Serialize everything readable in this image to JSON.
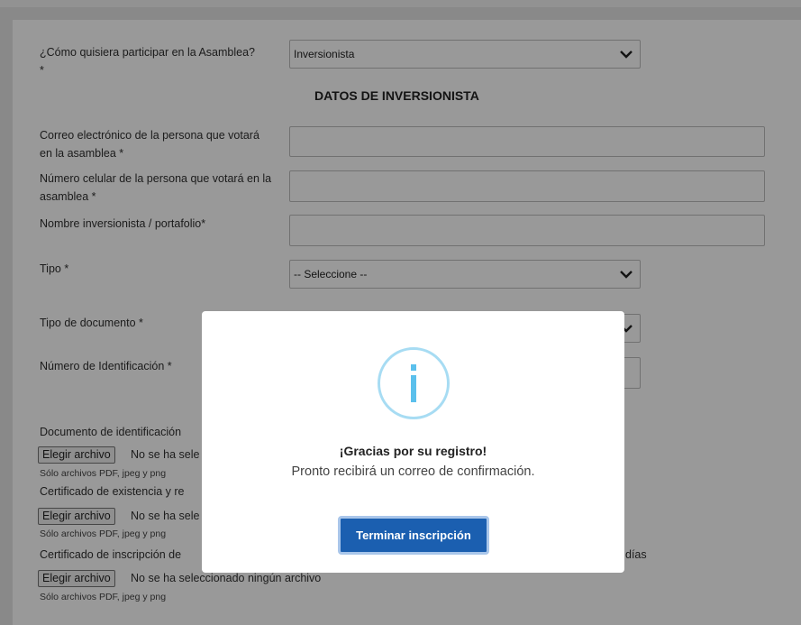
{
  "form": {
    "participation_label": "¿Cómo quisiera participar en la Asamblea? *",
    "participation_value": "Inversionista",
    "section_title": "DATOS DE INVERSIONISTA",
    "email_label": "Correo electrónico de la persona que votará en la asamblea *",
    "phone_label": "Número celular de la persona que votará en la asamblea *",
    "investor_name_label": "Nombre inversionista / portafolio*",
    "type_label": "Tipo *",
    "type_value": "-- Seleccione --",
    "doc_type_label": "Tipo de documento *",
    "id_number_label": "Número de Identificación *",
    "doc1_label": "Documento de identificación",
    "doc2_label": "Certificado de existencia y re",
    "doc3_label": "Certificado de inscripción de",
    "doc3_suffix": "días",
    "file_button_label": "Elegir archivo",
    "file_status_partial": "No se ha sele",
    "file_status_full": "No se ha seleccionado ningún archivo",
    "file_hint": "Sólo archivos PDF, jpeg y png"
  },
  "modal": {
    "icon": "info-icon",
    "icon_glyph": "i",
    "title": "¡Gracias por su registro!",
    "message": "Pronto recibirá un correo de confirmación.",
    "button_label": "Terminar inscripción"
  },
  "colors": {
    "accent": "#1b5fb0",
    "icon_ring": "#a7dcf3",
    "icon_glyph": "#5bc0ec",
    "overlay": "rgba(0,0,0,0.4)"
  }
}
